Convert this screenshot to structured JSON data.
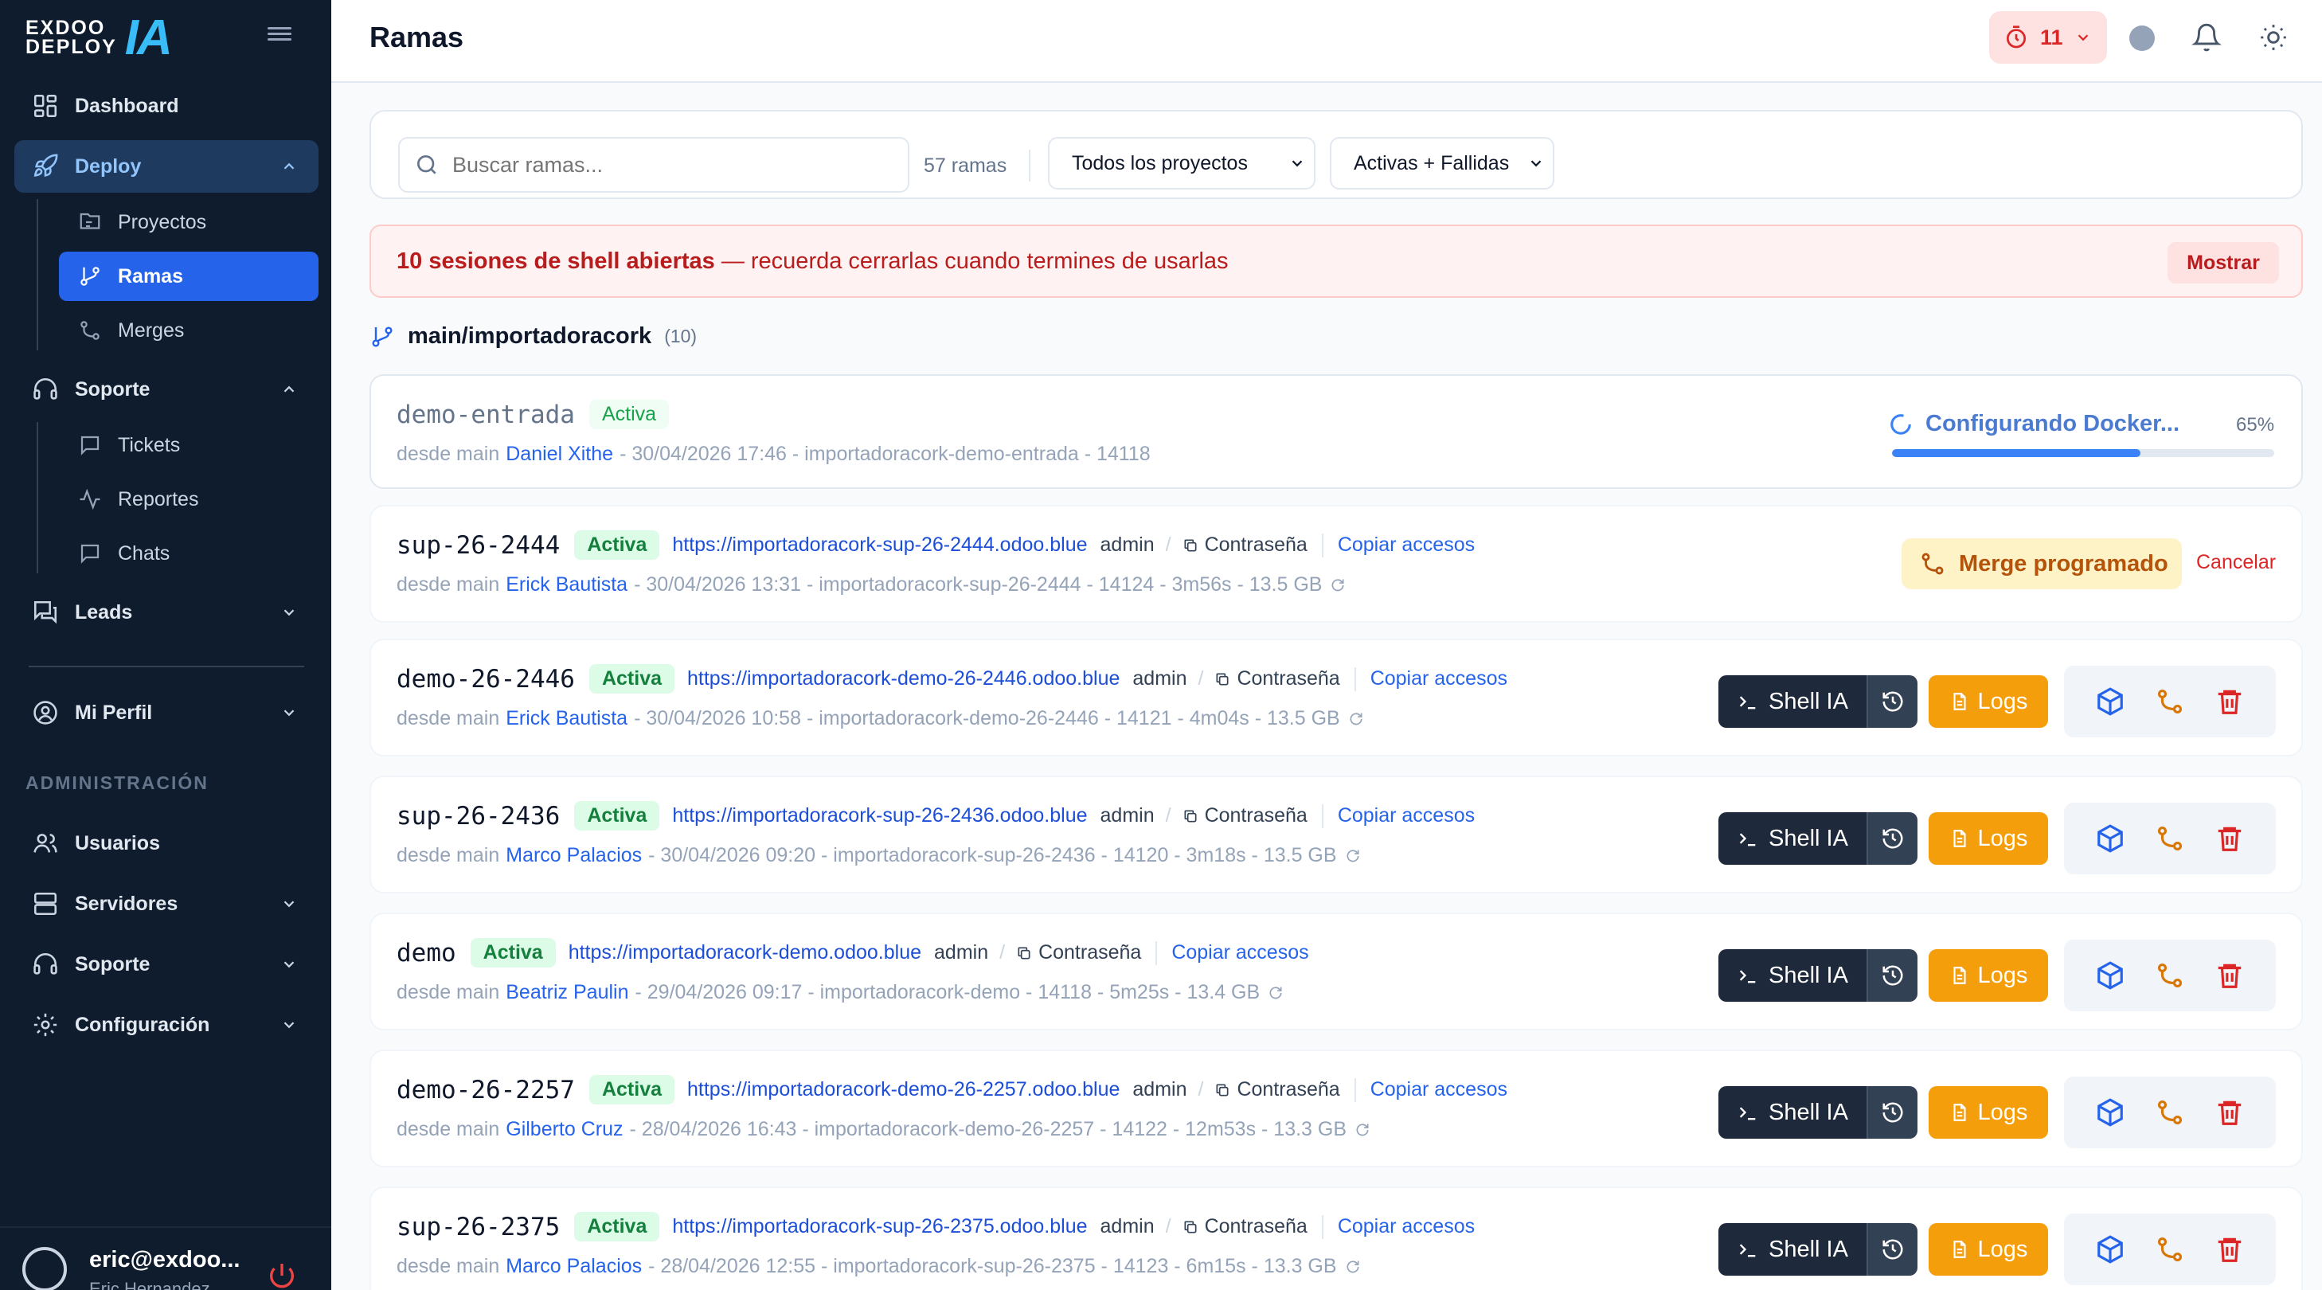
{
  "brand": {
    "line1": "EXDOO",
    "line2": "DEPLOY",
    "mark": "IA",
    "mark_color": "#38bdf8"
  },
  "sidebar": {
    "items": [
      {
        "label": "Dashboard",
        "icon": "dashboard-icon"
      },
      {
        "label": "Deploy",
        "icon": "rocket-icon",
        "expanded": true,
        "children": [
          {
            "label": "Proyectos",
            "icon": "folder-tree-icon"
          },
          {
            "label": "Ramas",
            "icon": "git-branch-icon",
            "active": true
          },
          {
            "label": "Merges",
            "icon": "git-merge-icon"
          }
        ]
      },
      {
        "label": "Soporte",
        "icon": "headset-icon",
        "expanded": true,
        "children": [
          {
            "label": "Tickets",
            "icon": "message-square-icon"
          },
          {
            "label": "Reportes",
            "icon": "activity-icon"
          },
          {
            "label": "Chats",
            "icon": "chat-icon"
          }
        ]
      },
      {
        "label": "Leads",
        "icon": "message-users-icon"
      }
    ],
    "profile": {
      "label": "Mi Perfil",
      "icon": "user-circle-icon"
    },
    "admin_section": "ADMINISTRACIÓN",
    "admin_items": [
      {
        "label": "Usuarios",
        "icon": "users-icon"
      },
      {
        "label": "Servidores",
        "icon": "server-icon"
      },
      {
        "label": "Soporte",
        "icon": "headset-icon"
      },
      {
        "label": "Configuración",
        "icon": "gear-icon"
      }
    ],
    "footer": {
      "email": "eric@exdoo...",
      "name": "Eric Hernandez"
    }
  },
  "header": {
    "title": "Ramas",
    "timer_count": "11"
  },
  "filters": {
    "search_placeholder": "Buscar ramas...",
    "count_text": "57 ramas",
    "project_select": "Todos los proyectos",
    "status_select": "Activas + Fallidas"
  },
  "alert": {
    "bold": "10 sesiones de shell abiertas",
    "rest": " — recuerda cerrarlas cuando termines de usarlas",
    "button": "Mostrar"
  },
  "group": {
    "name": "main/importadoracork",
    "count": "(10)"
  },
  "labels": {
    "user": "admin",
    "password": "Contraseña",
    "copy": "Copiar accesos",
    "from": "desde main",
    "shell": "Shell IA",
    "logs": "Logs",
    "merge_scheduled": "Merge programado",
    "cancel": "Cancelar",
    "configuring": "Configurando Docker...",
    "configuring_pct": "65%"
  },
  "progress_value": 0.65,
  "branches": [
    {
      "name": "demo-entrada",
      "status": "Activa",
      "url": "",
      "author": "Daniel Xithe",
      "meta": " - 30/04/2026 17:46 - importadoracork-demo-entrada - 14118",
      "state": "configuring"
    },
    {
      "name": "sup-26-2444",
      "status": "Activa",
      "url": "https://importadoracork-sup-26-2444.odoo.blue",
      "author": "Erick Bautista",
      "meta": " - 30/04/2026 13:31 - importadoracork-sup-26-2444 - 14124 - 3m56s - 13.5 GB",
      "state": "merge"
    },
    {
      "name": "demo-26-2446",
      "status": "Activa",
      "url": "https://importadoracork-demo-26-2446.odoo.blue",
      "author": "Erick Bautista",
      "meta": " - 30/04/2026 10:58 - importadoracork-demo-26-2446 - 14121 - 4m04s - 13.5 GB",
      "state": "normal"
    },
    {
      "name": "sup-26-2436",
      "status": "Activa",
      "url": "https://importadoracork-sup-26-2436.odoo.blue",
      "author": "Marco Palacios",
      "meta": " - 30/04/2026 09:20 - importadoracork-sup-26-2436 - 14120 - 3m18s - 13.5 GB",
      "state": "normal"
    },
    {
      "name": "demo",
      "status": "Activa",
      "url": "https://importadoracork-demo.odoo.blue",
      "author": "Beatriz Paulin",
      "meta": " - 29/04/2026 09:17 - importadoracork-demo - 14118 - 5m25s - 13.4 GB",
      "state": "normal"
    },
    {
      "name": "demo-26-2257",
      "status": "Activa",
      "url": "https://importadoracork-demo-26-2257.odoo.blue",
      "author": "Gilberto Cruz",
      "meta": " - 28/04/2026 16:43 - importadoracork-demo-26-2257 - 14122 - 12m53s - 13.3 GB",
      "state": "normal"
    },
    {
      "name": "sup-26-2375",
      "status": "Activa",
      "url": "https://importadoracork-sup-26-2375.odoo.blue",
      "author": "Marco Palacios",
      "meta": " - 28/04/2026 12:55 - importadoracork-sup-26-2375 - 14123 - 6m15s - 13.3 GB",
      "state": "normal"
    }
  ]
}
